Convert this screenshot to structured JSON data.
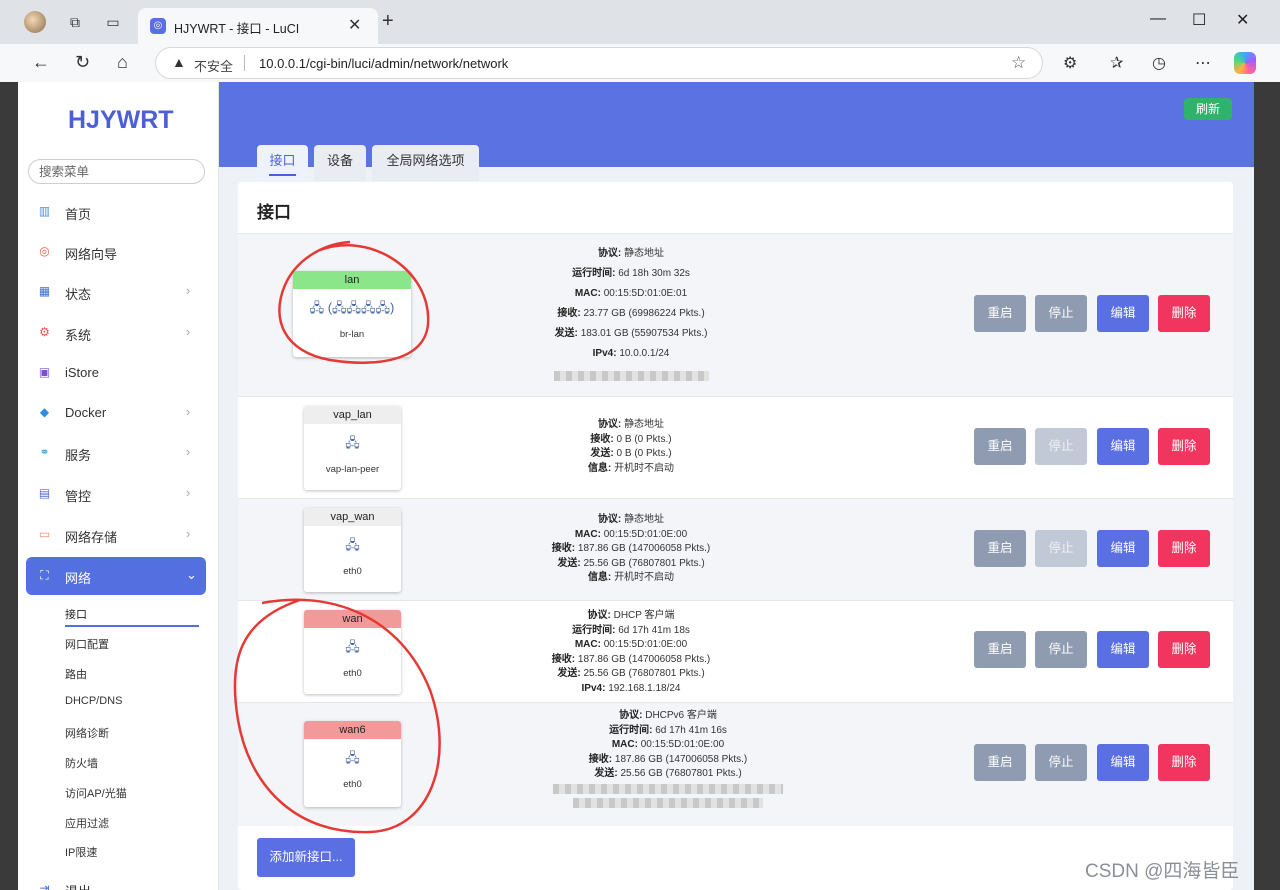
{
  "browser": {
    "tab_title": "HJYWRT - 接口 - LuCI",
    "close_glyph": "✕",
    "new_tab_glyph": "+",
    "insecure_label": "不安全",
    "url": "10.0.0.1/cgi-bin/luci/admin/network/network"
  },
  "sidebar": {
    "logo": "HJYWRT",
    "search_placeholder": "搜索菜单",
    "items": [
      {
        "label": "首页",
        "icon": "dashboard-icon",
        "color": "#4a90d9"
      },
      {
        "label": "网络向导",
        "icon": "wizard-icon",
        "color": "#e8604c"
      },
      {
        "label": "状态",
        "icon": "grid-icon",
        "color": "#3b6fd4"
      },
      {
        "label": "系统",
        "icon": "gear-icon",
        "color": "#e8554a"
      },
      {
        "label": "iStore",
        "icon": "store-icon",
        "color": "#7a4fd6"
      },
      {
        "label": "Docker",
        "icon": "docker-icon",
        "color": "#2d8de0"
      },
      {
        "label": "服务",
        "icon": "service-icon",
        "color": "#3aa0e0"
      },
      {
        "label": "管控",
        "icon": "control-icon",
        "color": "#4f6fd6"
      },
      {
        "label": "网络存储",
        "icon": "storage-icon",
        "color": "#f08a80"
      },
      {
        "label": "网络",
        "icon": "network-icon",
        "color": "#ffffff"
      }
    ],
    "sub_items": [
      "接口",
      "网口配置",
      "路由",
      "DHCP/DNS",
      "网络诊断",
      "防火墙",
      "访问AP/光猫",
      "应用过滤",
      "IP限速"
    ],
    "partial_item": "退出"
  },
  "header": {
    "refresh_label": "刷新",
    "tabs": [
      "接口",
      "设备",
      "全局网络选项"
    ]
  },
  "main": {
    "title": "接口",
    "buttons": {
      "restart": "重启",
      "stop": "停止",
      "edit": "编辑",
      "delete": "删除"
    },
    "add_label": "添加新接口...",
    "interfaces": [
      {
        "name": "lan",
        "device": "br-lan",
        "head_color": "#8be68a",
        "icons": "🖧 (🖧🖧🖧🖧)",
        "info": [
          {
            "k": "协议:",
            "v": "静态地址"
          },
          {
            "k": "运行时间:",
            "v": "6d 18h 30m 32s"
          },
          {
            "k": "MAC:",
            "v": "00:15:5D:01:0E:01"
          },
          {
            "k": "接收:",
            "v": "23.77 GB (69986224 Pkts.)"
          },
          {
            "k": "发送:",
            "v": "183.01 GB (55907534 Pkts.)"
          },
          {
            "k": "IPv4:",
            "v": "10.0.0.1/24"
          }
        ]
      },
      {
        "name": "vap_lan",
        "device": "vap-lan-peer",
        "head_color": "#eeeeee",
        "icons": "🖧",
        "info": [
          {
            "k": "协议:",
            "v": "静态地址"
          },
          {
            "k": "接收:",
            "v": "0 B (0 Pkts.)"
          },
          {
            "k": "发送:",
            "v": "0 B (0 Pkts.)"
          },
          {
            "k": "信息:",
            "v": "开机时不启动"
          }
        ]
      },
      {
        "name": "vap_wan",
        "device": "eth0",
        "head_color": "#eeeeee",
        "icons": "🖧",
        "info": [
          {
            "k": "协议:",
            "v": "静态地址"
          },
          {
            "k": "MAC:",
            "v": "00:15:5D:01:0E:00"
          },
          {
            "k": "接收:",
            "v": "187.86 GB (147006058 Pkts.)"
          },
          {
            "k": "发送:",
            "v": "25.56 GB (76807801 Pkts.)"
          },
          {
            "k": "信息:",
            "v": "开机时不启动"
          }
        ]
      },
      {
        "name": "wan",
        "device": "eth0",
        "head_color": "#f29a9a",
        "icons": "🖧",
        "info": [
          {
            "k": "协议:",
            "v": "DHCP 客户端"
          },
          {
            "k": "运行时间:",
            "v": "6d 17h 41m 18s"
          },
          {
            "k": "MAC:",
            "v": "00:15:5D:01:0E:00"
          },
          {
            "k": "接收:",
            "v": "187.86 GB (147006058 Pkts.)"
          },
          {
            "k": "发送:",
            "v": "25.56 GB (76807801 Pkts.)"
          },
          {
            "k": "IPv4:",
            "v": "192.168.1.18/24"
          }
        ]
      },
      {
        "name": "wan6",
        "device": "eth0",
        "head_color": "#f29a9a",
        "icons": "🖧",
        "info": [
          {
            "k": "协议:",
            "v": "DHCPv6 客户端"
          },
          {
            "k": "运行时间:",
            "v": "6d 17h 41m 16s"
          },
          {
            "k": "MAC:",
            "v": "00:15:5D:01:0E:00"
          },
          {
            "k": "接收:",
            "v": "187.86 GB (147006058 Pkts.)"
          },
          {
            "k": "发送:",
            "v": "25.56 GB (76807801 Pkts.)"
          }
        ]
      }
    ]
  },
  "watermark": "CSDN @四海皆臣"
}
